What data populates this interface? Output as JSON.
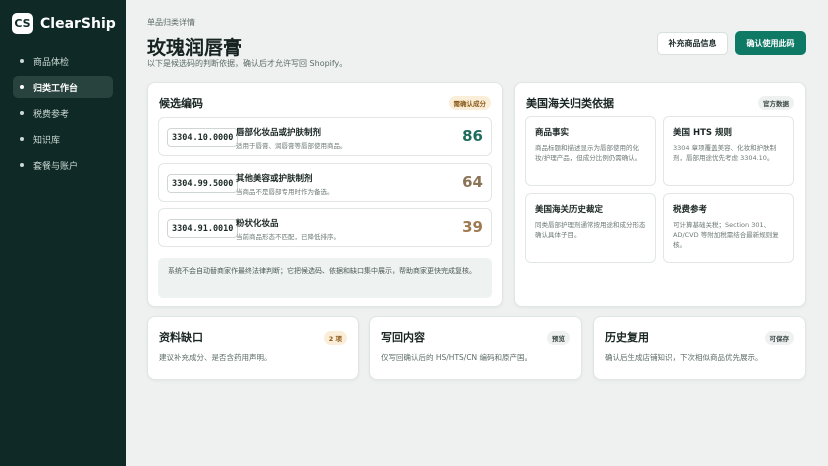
{
  "brand": {
    "logo": "CS",
    "name": "ClearShip"
  },
  "nav": [
    {
      "label": "商品体检",
      "active": false
    },
    {
      "label": "归类工作台",
      "active": true
    },
    {
      "label": "税费参考",
      "active": false
    },
    {
      "label": "知识库",
      "active": false
    },
    {
      "label": "套餐与账户",
      "active": false
    }
  ],
  "header": {
    "eyebrow": "单品归类详情",
    "title": "玫瑰润唇膏",
    "subtitle": "以下是候选码的判断依据，确认后才允许写回 Shopify。",
    "btn_secondary": "补充商品信息",
    "btn_primary": "确认使用此码"
  },
  "candidates": {
    "title": "候选编码",
    "badge": "需确认成分",
    "items": [
      {
        "code": "3304.10.0000",
        "name": "唇部化妆品或护肤制剂",
        "desc": "适用于唇膏、润唇膏等唇部使用商品。",
        "score": "86",
        "color": "#1f6b5d"
      },
      {
        "code": "3304.99.5000",
        "name": "其他美容或护肤制剂",
        "desc": "当商品不是唇部专用时作为备选。",
        "score": "64",
        "color": "#8a7356"
      },
      {
        "code": "3304.91.0010",
        "name": "粉状化妆品",
        "desc": "当前商品形态不匹配，已降低排序。",
        "score": "39",
        "color": "#a07a52"
      }
    ],
    "note": "系统不会自动替商家作最终法律判断；它把候选码、依据和缺口集中展示，帮助商家更快完成复核。"
  },
  "basis": {
    "title": "美国海关归类依据",
    "badge": "官方数据",
    "items": [
      {
        "title": "商品事实",
        "desc": "商品标题和描述显示为唇部使用的化妆/护理产品，但成分比例仍需确认。"
      },
      {
        "title": "美国 HTS 规则",
        "desc": "3304 章项覆盖美容、化妆和护肤制剂，唇部用途优先考虑 3304.10。"
      },
      {
        "title": "美国海关历史裁定",
        "desc": "同类唇部护理剂通常按用途和成分形态确认具体子目。"
      },
      {
        "title": "税费参考",
        "desc": "可计算基础关税；Section 301、AD/CVD 等附加税需结合最新规则复核。"
      }
    ]
  },
  "bottom": [
    {
      "title": "资料缺口",
      "badge": "2 项",
      "desc": "建议补充成分、是否含药用声明。"
    },
    {
      "title": "写回内容",
      "badge": "预览",
      "desc": "仅写回确认后的 HS/HTS/CN 编码和原产国。"
    },
    {
      "title": "历史复用",
      "badge": "可保存",
      "desc": "确认后生成店铺知识，下次相似商品优先展示。"
    }
  ]
}
